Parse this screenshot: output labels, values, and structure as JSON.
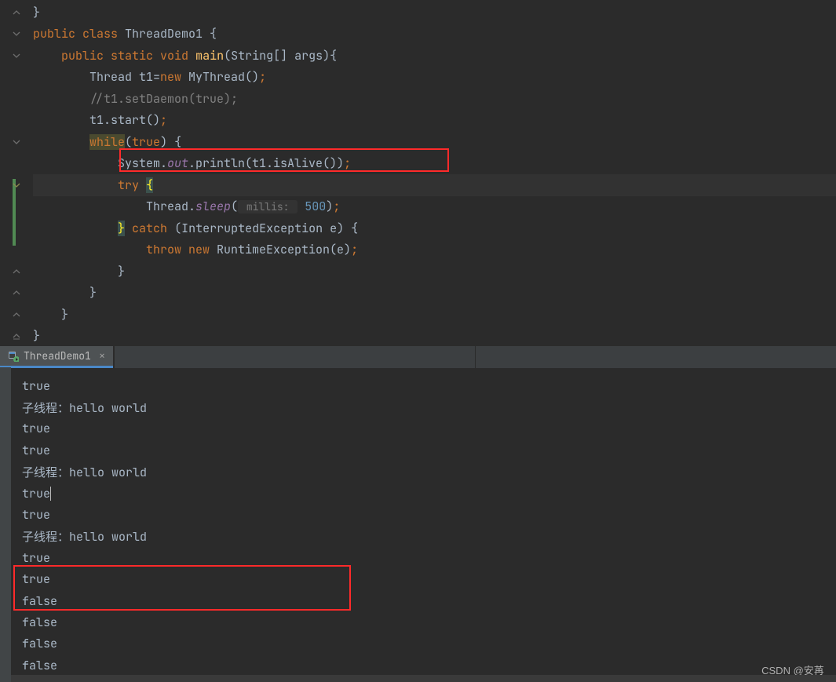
{
  "editor": {
    "lines": [
      {
        "ind": 0,
        "segs": [
          {
            "t": "}",
            "c": ""
          }
        ]
      },
      {
        "ind": 0,
        "segs": [
          {
            "t": "public ",
            "c": "kw"
          },
          {
            "t": "class ",
            "c": "kw"
          },
          {
            "t": "ThreadDemo1 ",
            "c": "cls"
          },
          {
            "t": "{",
            "c": ""
          }
        ]
      },
      {
        "ind": 4,
        "segs": [
          {
            "t": "public ",
            "c": "kw"
          },
          {
            "t": "static ",
            "c": "kw"
          },
          {
            "t": "void ",
            "c": "kw"
          },
          {
            "t": "main",
            "c": "fn"
          },
          {
            "t": "(String[] args){",
            "c": ""
          }
        ]
      },
      {
        "ind": 8,
        "segs": [
          {
            "t": "Thread t1=",
            "c": ""
          },
          {
            "t": "new ",
            "c": "kw"
          },
          {
            "t": "MyThread()",
            "c": ""
          },
          {
            "t": ";",
            "c": "kw"
          }
        ]
      },
      {
        "ind": 8,
        "segs": [
          {
            "t": "//t1.setDaemon(true);",
            "c": "cmt"
          }
        ]
      },
      {
        "ind": 8,
        "segs": [
          {
            "t": "t1.start()",
            "c": ""
          },
          {
            "t": ";",
            "c": "kw"
          }
        ]
      },
      {
        "ind": 8,
        "segs": [
          {
            "t": "while",
            "c": "hl-kw"
          },
          {
            "t": "(",
            "c": ""
          },
          {
            "t": "true",
            "c": "kw"
          },
          {
            "t": ") {",
            "c": ""
          }
        ]
      },
      {
        "ind": 12,
        "segs": [
          {
            "t": "System.",
            "c": ""
          },
          {
            "t": "out",
            "c": "fld-i"
          },
          {
            "t": ".println(t1.isAlive())",
            "c": ""
          },
          {
            "t": ";",
            "c": "kw"
          }
        ]
      },
      {
        "ind": 12,
        "cursor": true,
        "segs": [
          {
            "t": "try ",
            "c": "kw"
          },
          {
            "t": "{",
            "c": "hl-brace"
          }
        ]
      },
      {
        "ind": 16,
        "segs": [
          {
            "t": "Thread.",
            "c": ""
          },
          {
            "t": "sleep",
            "c": "fld-s"
          },
          {
            "t": "(",
            "c": ""
          },
          {
            "t": " millis: ",
            "c": "param-hint"
          },
          {
            "t": " ",
            "c": ""
          },
          {
            "t": "500",
            "c": "num"
          },
          {
            "t": ")",
            "c": ""
          },
          {
            "t": ";",
            "c": "kw"
          }
        ]
      },
      {
        "ind": 12,
        "segs": [
          {
            "t": "}",
            "c": "hl-brace"
          },
          {
            "t": " ",
            "c": ""
          },
          {
            "t": "catch ",
            "c": "kw"
          },
          {
            "t": "(InterruptedException e) {",
            "c": ""
          }
        ]
      },
      {
        "ind": 16,
        "segs": [
          {
            "t": "throw ",
            "c": "kw"
          },
          {
            "t": "new ",
            "c": "kw"
          },
          {
            "t": "RuntimeException(e)",
            "c": ""
          },
          {
            "t": ";",
            "c": "kw"
          }
        ]
      },
      {
        "ind": 12,
        "segs": [
          {
            "t": "}",
            "c": ""
          }
        ]
      },
      {
        "ind": 8,
        "segs": [
          {
            "t": "}",
            "c": ""
          }
        ]
      },
      {
        "ind": 4,
        "segs": [
          {
            "t": "}",
            "c": ""
          }
        ]
      },
      {
        "ind": 0,
        "segs": [
          {
            "t": "}",
            "c": ""
          }
        ]
      }
    ],
    "gutter": [
      "up",
      "down",
      "down",
      "",
      "",
      "",
      "down",
      "",
      "down-h",
      "",
      "",
      "",
      "up",
      "up",
      "up",
      "up-final"
    ]
  },
  "tab": {
    "title": "ThreadDemo1"
  },
  "console": {
    "lines": [
      "true",
      "子线程：hello world",
      "true",
      "true",
      "子线程：hello world",
      "true|",
      "true",
      "子线程：hello world",
      "true",
      "true",
      "false",
      "false",
      "false",
      "false"
    ]
  },
  "watermark": "CSDN @安苒_"
}
